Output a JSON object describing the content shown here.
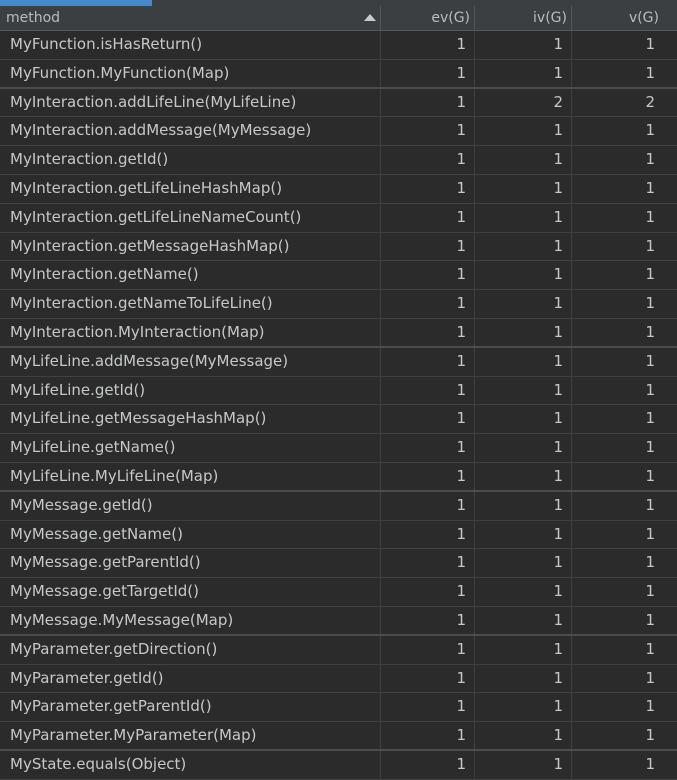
{
  "header": {
    "method": "method",
    "ev": "ev(G)",
    "iv": "iv(G)",
    "v": "v(G)",
    "sort_icon": "sort-ascending-icon"
  },
  "rows": [
    {
      "method": "MyFunction.isHasReturn()",
      "ev": "1",
      "iv": "1",
      "v": "1"
    },
    {
      "method": "MyFunction.MyFunction(Map)",
      "ev": "1",
      "iv": "1",
      "v": "1"
    },
    {
      "method": "MyInteraction.addLifeLine(MyLifeLine)",
      "ev": "1",
      "iv": "2",
      "v": "2"
    },
    {
      "method": "MyInteraction.addMessage(MyMessage)",
      "ev": "1",
      "iv": "1",
      "v": "1"
    },
    {
      "method": "MyInteraction.getId()",
      "ev": "1",
      "iv": "1",
      "v": "1"
    },
    {
      "method": "MyInteraction.getLifeLineHashMap()",
      "ev": "1",
      "iv": "1",
      "v": "1"
    },
    {
      "method": "MyInteraction.getLifeLineNameCount()",
      "ev": "1",
      "iv": "1",
      "v": "1"
    },
    {
      "method": "MyInteraction.getMessageHashMap()",
      "ev": "1",
      "iv": "1",
      "v": "1"
    },
    {
      "method": "MyInteraction.getName()",
      "ev": "1",
      "iv": "1",
      "v": "1"
    },
    {
      "method": "MyInteraction.getNameToLifeLine()",
      "ev": "1",
      "iv": "1",
      "v": "1"
    },
    {
      "method": "MyInteraction.MyInteraction(Map)",
      "ev": "1",
      "iv": "1",
      "v": "1"
    },
    {
      "method": "MyLifeLine.addMessage(MyMessage)",
      "ev": "1",
      "iv": "1",
      "v": "1"
    },
    {
      "method": "MyLifeLine.getId()",
      "ev": "1",
      "iv": "1",
      "v": "1"
    },
    {
      "method": "MyLifeLine.getMessageHashMap()",
      "ev": "1",
      "iv": "1",
      "v": "1"
    },
    {
      "method": "MyLifeLine.getName()",
      "ev": "1",
      "iv": "1",
      "v": "1"
    },
    {
      "method": "MyLifeLine.MyLifeLine(Map)",
      "ev": "1",
      "iv": "1",
      "v": "1"
    },
    {
      "method": "MyMessage.getId()",
      "ev": "1",
      "iv": "1",
      "v": "1"
    },
    {
      "method": "MyMessage.getName()",
      "ev": "1",
      "iv": "1",
      "v": "1"
    },
    {
      "method": "MyMessage.getParentId()",
      "ev": "1",
      "iv": "1",
      "v": "1"
    },
    {
      "method": "MyMessage.getTargetId()",
      "ev": "1",
      "iv": "1",
      "v": "1"
    },
    {
      "method": "MyMessage.MyMessage(Map)",
      "ev": "1",
      "iv": "1",
      "v": "1"
    },
    {
      "method": "MyParameter.getDirection()",
      "ev": "1",
      "iv": "1",
      "v": "1"
    },
    {
      "method": "MyParameter.getId()",
      "ev": "1",
      "iv": "1",
      "v": "1"
    },
    {
      "method": "MyParameter.getParentId()",
      "ev": "1",
      "iv": "1",
      "v": "1"
    },
    {
      "method": "MyParameter.MyParameter(Map)",
      "ev": "1",
      "iv": "1",
      "v": "1"
    },
    {
      "method": "MyState.equals(Object)",
      "ev": "1",
      "iv": "1",
      "v": "1"
    }
  ],
  "colors": {
    "background": "#2b2b2b",
    "header_background": "#3c3f41",
    "accent": "#4a88c7",
    "text": "#c5c8cb"
  }
}
